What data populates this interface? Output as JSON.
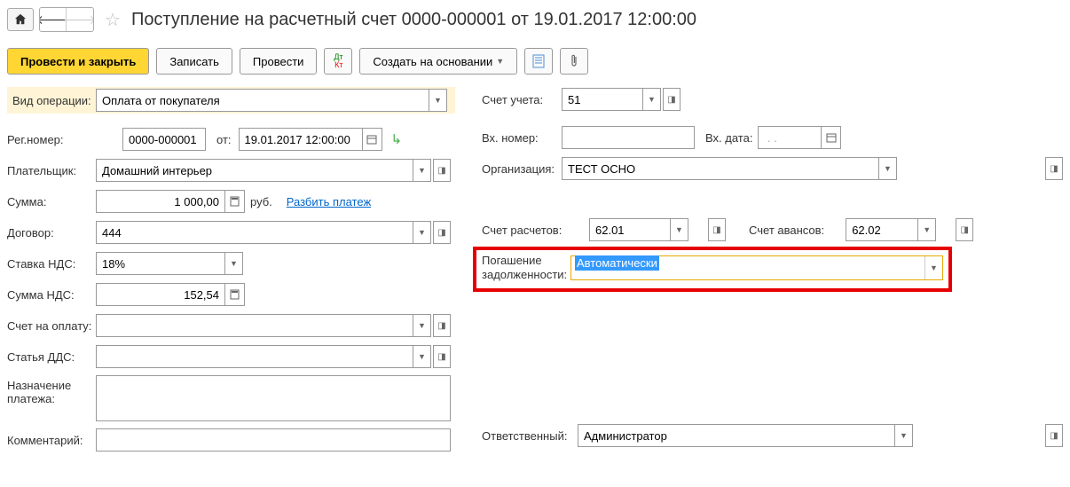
{
  "header": {
    "title": "Поступление на расчетный счет 0000-000001 от 19.01.2017 12:00:00"
  },
  "toolbar": {
    "post_and_close": "Провести и закрыть",
    "save": "Записать",
    "post": "Провести",
    "create_based": "Создать на основании"
  },
  "labels": {
    "operation_type": "Вид операции:",
    "reg_number": "Рег.номер:",
    "from": "от:",
    "payer": "Плательщик:",
    "sum": "Сумма:",
    "contract": "Договор:",
    "vat_rate": "Ставка НДС:",
    "vat_sum": "Сумма НДС:",
    "invoice": "Счет на оплату:",
    "dds": "Статья ДДС:",
    "purpose": "Назначение платежа:",
    "comment": "Комментарий:",
    "account": "Счет учета:",
    "in_number": "Вх. номер:",
    "in_date": "Вх. дата:",
    "organization": "Организация:",
    "calc_account": "Счет расчетов:",
    "advance_account": "Счет авансов:",
    "debt_repay": "Погашение задолженности:",
    "responsible": "Ответственный:",
    "currency": "руб.",
    "split_payment": "Разбить платеж"
  },
  "values": {
    "operation_type": "Оплата от покупателя",
    "reg_number": "0000-000001",
    "date": "19.01.2017 12:00:00",
    "payer": "Домашний интерьер",
    "sum": "1 000,00",
    "contract": "444",
    "vat_rate": "18%",
    "vat_sum": "152,54",
    "invoice": "",
    "dds": "",
    "purpose": "",
    "comment": "",
    "account": "51",
    "in_number": "",
    "in_date_placeholder": " . . ",
    "organization": "ТЕСТ ОСНО",
    "calc_account": "62.01",
    "advance_account": "62.02",
    "debt_repay": "Автоматически",
    "responsible": "Администратор"
  }
}
